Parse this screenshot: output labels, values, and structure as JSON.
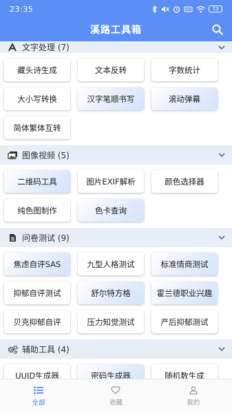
{
  "status_bar": {
    "time": "23:35",
    "battery": "73"
  },
  "app_bar": {
    "title": "溪路工具箱",
    "search_icon": "search-icon"
  },
  "sections": [
    {
      "icon": "font-icon",
      "title": "文字处理 (7)",
      "tools": [
        {
          "label": "藏头诗生成",
          "highlighted": false
        },
        {
          "label": "文本反转",
          "highlighted": false
        },
        {
          "label": "字数统计",
          "highlighted": false
        },
        {
          "label": "大小写转换",
          "highlighted": false
        },
        {
          "label": "汉字笔顺书写",
          "highlighted": true
        },
        {
          "label": "滚动弹幕",
          "highlighted": true
        },
        {
          "label": "简体繁体互转",
          "highlighted": false
        }
      ]
    },
    {
      "icon": "images-icon",
      "title": "图像视频 (5)",
      "tools": [
        {
          "label": "二维码工具",
          "highlighted": true
        },
        {
          "label": "图片EXIF解析",
          "highlighted": false
        },
        {
          "label": "颜色选择器",
          "highlighted": false
        },
        {
          "label": "纯色图制作",
          "highlighted": false
        },
        {
          "label": "色卡查询",
          "highlighted": true
        }
      ]
    },
    {
      "icon": "file-text-icon",
      "title": "问卷测试 (9)",
      "tools": [
        {
          "label": "焦虑自评SAS",
          "highlighted": true
        },
        {
          "label": "九型人格测试",
          "highlighted": false
        },
        {
          "label": "标准情商测试",
          "highlighted": true
        },
        {
          "label": "抑郁自评测试",
          "highlighted": false
        },
        {
          "label": "舒尔特方格",
          "highlighted": true
        },
        {
          "label": "霍兰德职业兴趣",
          "highlighted": true
        },
        {
          "label": "贝克抑郁自评",
          "highlighted": false
        },
        {
          "label": "压力知觉测试",
          "highlighted": false
        },
        {
          "label": "产后抑郁测试",
          "highlighted": false
        }
      ]
    },
    {
      "icon": "cogs-icon",
      "title": "辅助工具 (4)",
      "tools": [
        {
          "label": "UUID生成器",
          "highlighted": false
        },
        {
          "label": "密码生成器",
          "highlighted": true
        },
        {
          "label": "随机数生成",
          "highlighted": false
        }
      ]
    }
  ],
  "bottom_nav": [
    {
      "label": "全部",
      "icon": "list-icon",
      "active": true
    },
    {
      "label": "收藏",
      "icon": "heart-icon",
      "active": false
    },
    {
      "label": "我的",
      "icon": "user-icon",
      "active": false
    }
  ],
  "colors": {
    "primary": "#5b8ff5",
    "section_bg": "#e8eef8",
    "active_nav": "#4a7ef0"
  }
}
